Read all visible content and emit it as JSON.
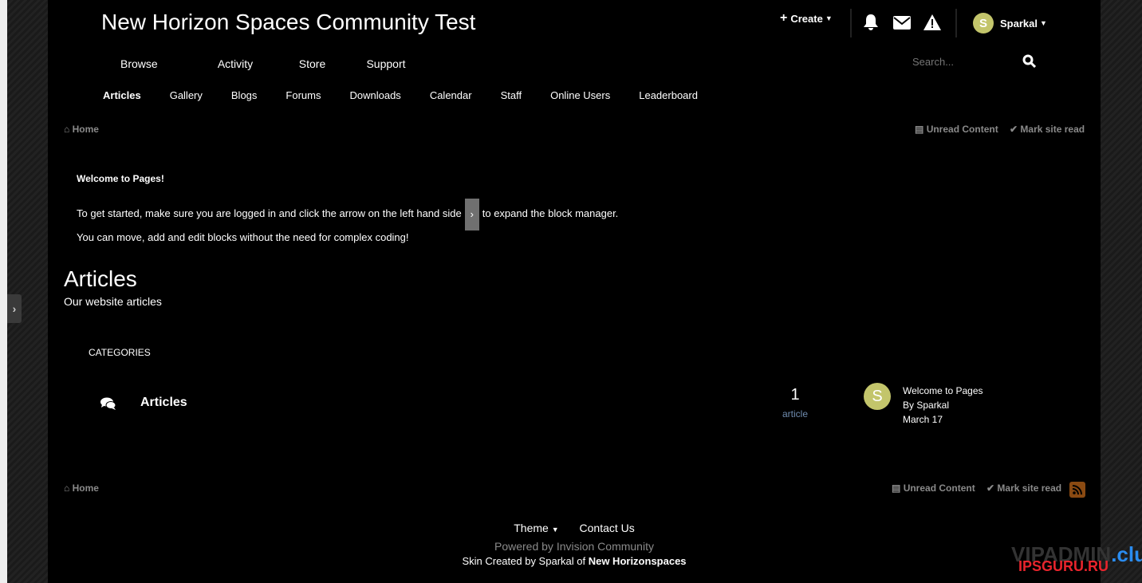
{
  "site_title": "New Horizon Spaces Community Test",
  "topbar": {
    "create_label": "Create",
    "user_name": "Sparkal",
    "user_initial": "S"
  },
  "search": {
    "placeholder": "Search..."
  },
  "primary_nav": [
    "Browse",
    "Activity",
    "Store",
    "Support"
  ],
  "secondary_nav": [
    "Articles",
    "Gallery",
    "Blogs",
    "Forums",
    "Downloads",
    "Calendar",
    "Staff",
    "Online Users",
    "Leaderboard"
  ],
  "breadcrumb": {
    "home": "Home",
    "unread": "Unread Content",
    "mark_read": "Mark site read"
  },
  "welcome": {
    "heading": "Welcome to Pages!",
    "line1_a": "To get started, make sure you are logged in and click the arrow on the left hand side",
    "line1_b": "to expand the block manager.",
    "line2": "You can move, add and edit blocks without the need for complex coding!"
  },
  "page": {
    "title": "Articles",
    "subtitle": "Our website articles"
  },
  "categories": {
    "header": "CATEGORIES",
    "items": [
      {
        "name": "Articles",
        "count": "1",
        "count_label": "article",
        "last_title": "Welcome to Pages",
        "last_by": "By Sparkal",
        "last_date": "March 17",
        "avatar_initial": "S"
      }
    ]
  },
  "footer": {
    "theme": "Theme",
    "contact": "Contact Us",
    "powered": "Powered by Invision Community",
    "skin_prefix": "Skin Created by Sparkal of",
    "skin_site": "New Horizonspaces"
  },
  "watermark": "VIPADMIN.club IPSGURU.RU",
  "colors": {
    "avatar": "#c3c56b",
    "rss": "#c4701e",
    "muted": "#8a8a8a",
    "count_label": "#6f8bae"
  }
}
